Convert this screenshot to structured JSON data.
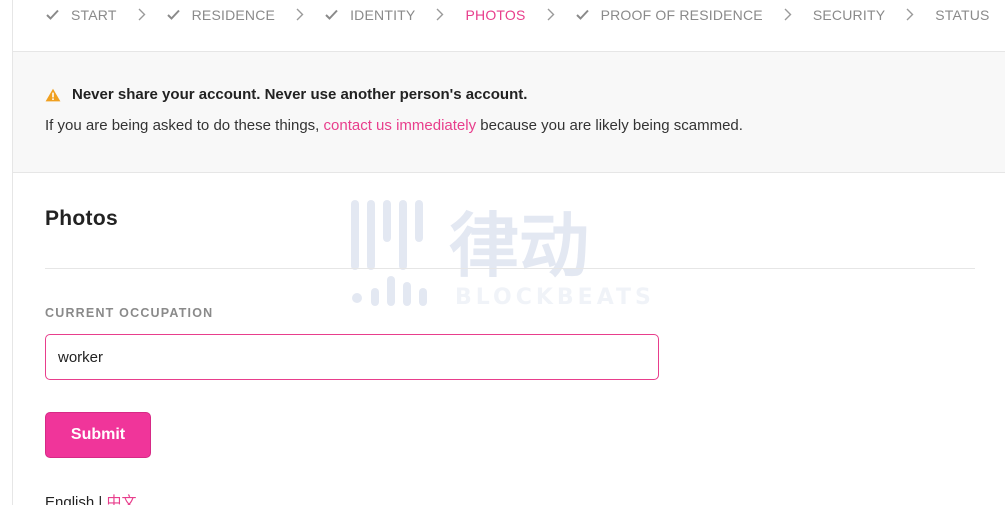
{
  "stepper": {
    "steps": [
      {
        "label": "START",
        "done": true,
        "active": false
      },
      {
        "label": "RESIDENCE",
        "done": true,
        "active": false
      },
      {
        "label": "IDENTITY",
        "done": true,
        "active": false
      },
      {
        "label": "PHOTOS",
        "done": false,
        "active": true
      },
      {
        "label": "PROOF OF RESIDENCE",
        "done": true,
        "active": false
      },
      {
        "label": "SECURITY",
        "done": false,
        "active": false
      },
      {
        "label": "STATUS",
        "done": false,
        "active": false
      }
    ]
  },
  "banner": {
    "warning": "Never share your account. Never use another person's account.",
    "info_prefix": "If you are being asked to do these things, ",
    "info_link": "contact us immediately",
    "info_suffix": " because you are likely being scammed."
  },
  "section": {
    "title": "Photos",
    "field_label": "CURRENT OCCUPATION",
    "field_value": "worker",
    "submit_label": "Submit"
  },
  "language": {
    "current": "English",
    "separator": " | ",
    "alternate": "中文"
  },
  "watermark": {
    "brand_cn": "律动",
    "brand_en": "BLOCKBEATS"
  },
  "colors": {
    "accent": "#e83e8c",
    "button": "#f0359a",
    "muted": "#8a8a8a",
    "warning": "#f0a020"
  }
}
